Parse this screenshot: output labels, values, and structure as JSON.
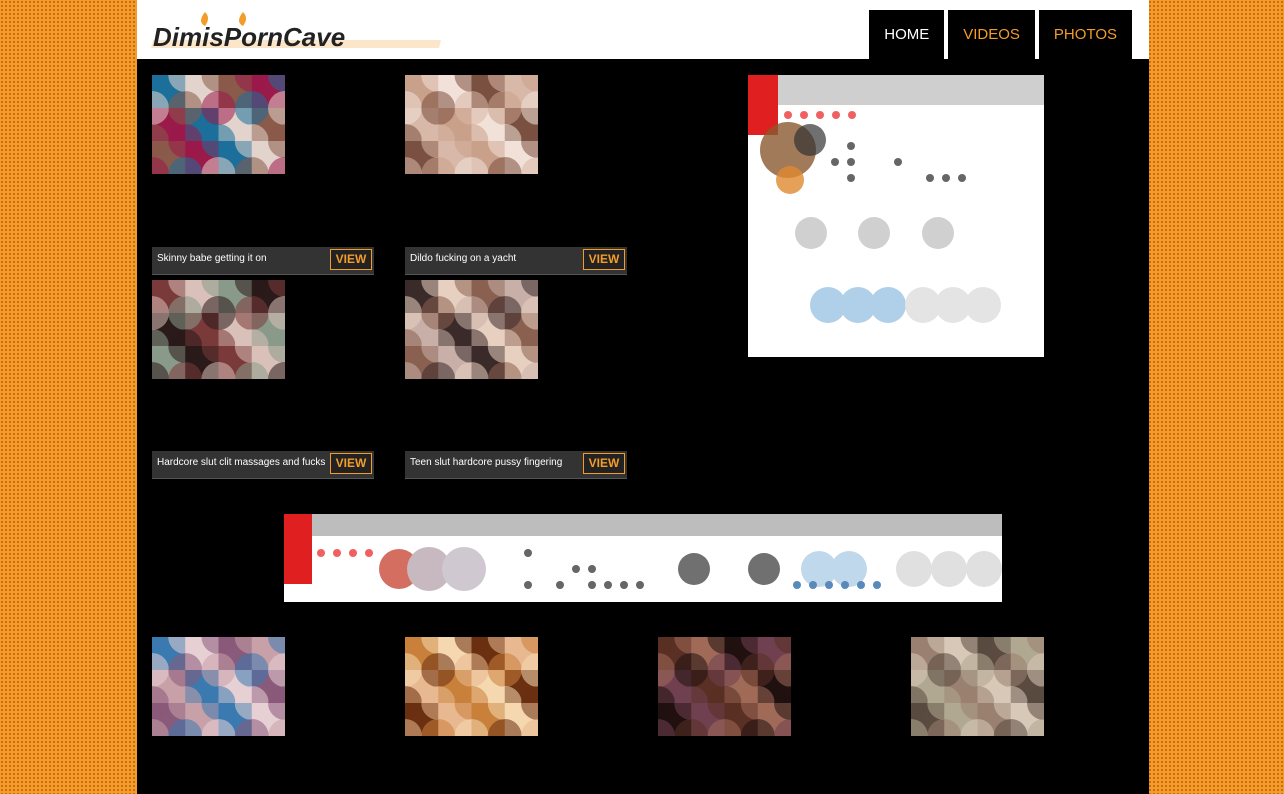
{
  "brand": {
    "logo_text": "DimisPornCave",
    "accent_color": "#f39c2a"
  },
  "nav": [
    {
      "label": "HOME"
    },
    {
      "label": "VIDEOS"
    },
    {
      "label": "PHOTOS"
    }
  ],
  "videos": [
    {
      "title": "Skinny babe getting it on",
      "button": "VIEW",
      "colors": [
        "#1b6f9a",
        "#e2d4cc",
        "#8a5a4a",
        "#9a1a4a"
      ]
    },
    {
      "title": "Dildo fucking on a yacht",
      "button": "VIEW",
      "colors": [
        "#c9a08a",
        "#f1e1d8",
        "#7a5040",
        "#d8b8a8"
      ]
    },
    {
      "title": "Hardcore slut clit massages and fucks",
      "button": "VIEW",
      "colors": [
        "#7a3a3a",
        "#d9c0b8",
        "#8a9a8a",
        "#2a1a1a"
      ]
    },
    {
      "title": "Teen slut hardcore pussy fingering",
      "button": "VIEW",
      "colors": [
        "#3a2a2a",
        "#e8d0c0",
        "#8a6050",
        "#c8b0a8"
      ]
    }
  ],
  "bottom_thumbs": [
    {
      "colors": [
        "#3a7ab0",
        "#e6d0d4",
        "#8a5a7a",
        "#c8a0a8"
      ]
    },
    {
      "colors": [
        "#c8803a",
        "#f6d8b0",
        "#6a3010",
        "#e8b890"
      ]
    },
    {
      "colors": [
        "#5a3024",
        "#a06a58",
        "#201010",
        "#704050"
      ]
    },
    {
      "colors": [
        "#9a8070",
        "#d8c8b8",
        "#5a4a40",
        "#b0a890"
      ]
    }
  ]
}
